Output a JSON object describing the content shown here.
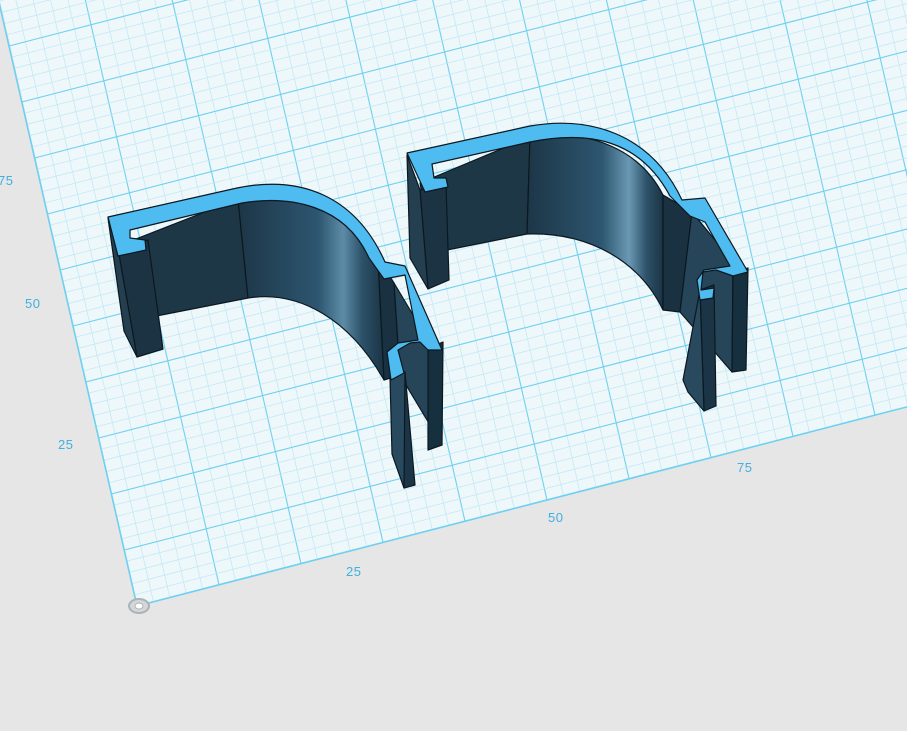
{
  "app": "3D modeling workspace",
  "workplane": {
    "grid_color": "#6fd0f0",
    "grid_fine_color": "#bfe8f5",
    "plane_color": "#eef7fa",
    "background": "#e6e6e6",
    "x_axis_labels": [
      "25",
      "50",
      "75"
    ],
    "y_axis_labels": [
      "25",
      "50",
      "75"
    ]
  },
  "objects": [
    {
      "name": "left-clip-part",
      "top_color": "#4ebcf0",
      "side_color": "#1f3a4b"
    },
    {
      "name": "right-clip-part",
      "top_color": "#4ebcf0",
      "side_color": "#1f3a4b"
    }
  ]
}
